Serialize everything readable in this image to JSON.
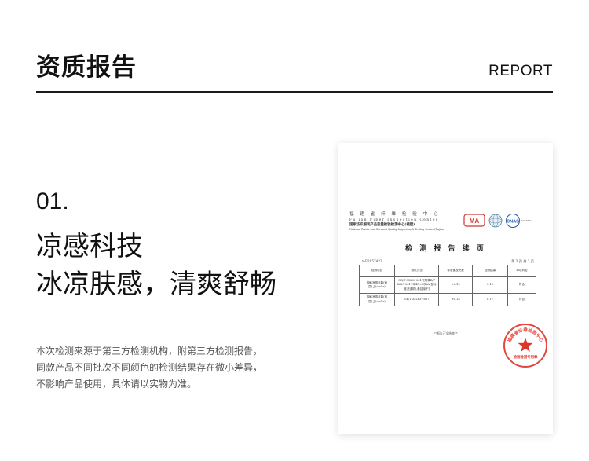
{
  "header": {
    "title": "资质报告",
    "tag": "REPORT"
  },
  "section": {
    "number": "01.",
    "headline_line1": "凉感科技",
    "headline_line2": "冰凉肤感，清爽舒畅",
    "body_lines": [
      "本次检测来源于第三方检测机构，附第三方检测报告，",
      "同款产品不同批次不同颜色的检测结果存在微小差异，",
      "不影响产品使用，具体请以实物为准。"
    ]
  },
  "report": {
    "institution_cn": "福 建 省 纤 维 检 验 中 心",
    "institution_en": "Fujian Fiber Inspection Center",
    "institution_cn2": "国家纺织服装产品质量检验检测中心(福建)",
    "institution_en2": "National Textile and Garment Quality Inspection & Testing Center (Fujian)",
    "logo_cma": "MA",
    "logo_cnas": "CNAS",
    "cnas_note": "TESTING",
    "title": "检 测 报 告 续 页",
    "report_no": "№E2057423",
    "page": "第 3 页 共 3 页",
    "table_headers": [
      "检测项目",
      "测试方法",
      "标准值及允差",
      "检测结果",
      "单项判定"
    ],
    "rows": [
      {
        "item": "接触凉感系数(面层),J/(cm²·s)",
        "method": "GB/T 35263-2017[附录B/T 8629-2017中4G×5次(A)型标准洗涤机),悬挂晾干]",
        "standard": "≥0.15",
        "result": "0.16",
        "verdict": "符合"
      },
      {
        "item": "接触凉感系数(底层),J/(cm²·s)",
        "method": "GB/T 35263-2017",
        "standard": "≥0.15",
        "result": "0.17",
        "verdict": "符合"
      }
    ],
    "end_note": "**报告正文结束**",
    "seal_text": "福建省纤维检验中心",
    "seal_subtext": "检验检测专用章"
  }
}
